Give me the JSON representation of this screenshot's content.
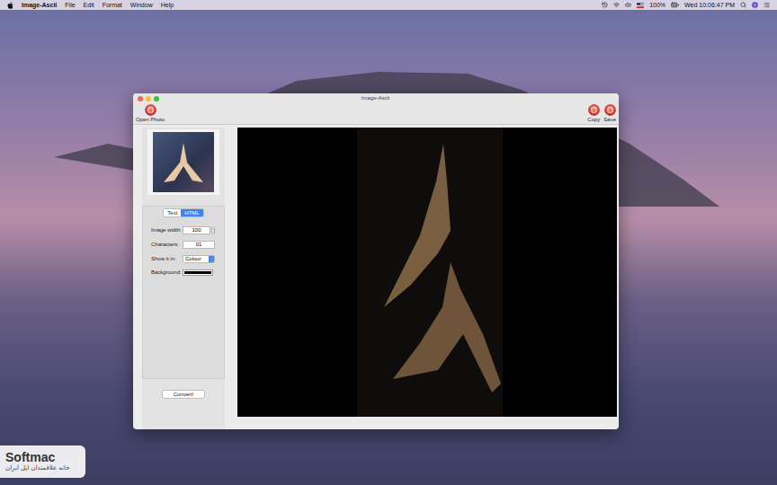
{
  "menu_bar": {
    "app": "Image-Ascii",
    "menus": [
      "File",
      "Edit",
      "Format",
      "Window",
      "Help"
    ],
    "battery": "100%",
    "clock": "Wed 10:06:47 PM"
  },
  "window": {
    "title": "Image-Ascii"
  },
  "toolbar": {
    "left": [
      {
        "label": "Open Photo"
      }
    ],
    "right": [
      {
        "label": "Copy"
      },
      {
        "label": "Save"
      }
    ]
  },
  "tabs": [
    {
      "label": "Text",
      "selected": false
    },
    {
      "label": "HTML",
      "selected": true
    }
  ],
  "fields": [
    {
      "kind": "stepper",
      "label": "Image width:",
      "value": "100"
    },
    {
      "kind": "text",
      "label": "Characters:",
      "value": "01"
    },
    {
      "kind": "select",
      "label": "Show it in:",
      "value": "Colour"
    },
    {
      "kind": "color",
      "label": "Background:",
      "color": "#000000"
    }
  ],
  "convert_button": "Convert!",
  "watermark": {
    "brand": "Softmac",
    "tagline": "خانه علاقمندان اپل ایران"
  }
}
